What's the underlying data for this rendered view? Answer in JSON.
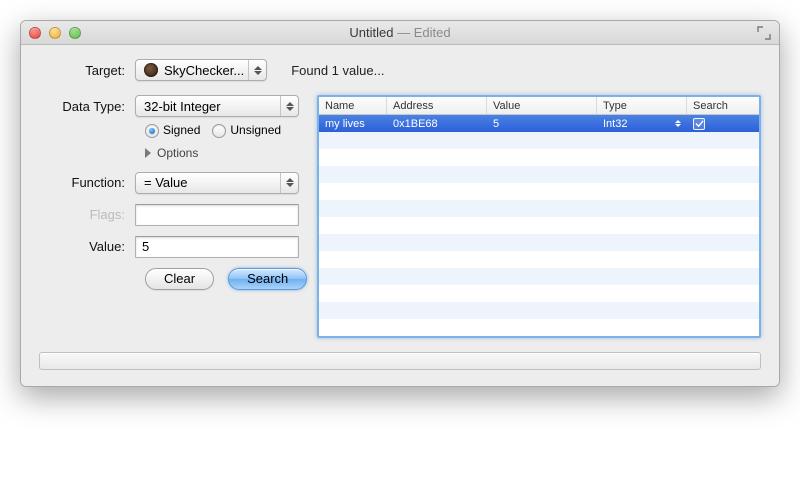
{
  "window": {
    "title": "Untitled",
    "edited_suffix": " — Edited"
  },
  "toprow": {
    "target_label": "Target:",
    "target_value": "SkyChecker...",
    "status_text": "Found 1 value..."
  },
  "form": {
    "data_type_label": "Data Type:",
    "data_type_value": "32-bit Integer",
    "signed_label": "Signed",
    "unsigned_label": "Unsigned",
    "signed_selected": true,
    "options_label": "Options",
    "function_label": "Function:",
    "function_value": "= Value",
    "flags_label": "Flags:",
    "flags_value": "",
    "value_label": "Value:",
    "value_value": "5",
    "clear_button": "Clear",
    "search_button": "Search"
  },
  "table": {
    "columns": {
      "name": "Name",
      "address": "Address",
      "value": "Value",
      "type": "Type",
      "search": "Search"
    },
    "rows": [
      {
        "name": "my lives",
        "address": "0x1BE68",
        "value": "5",
        "type": "Int32",
        "search_checked": true,
        "selected": true
      }
    ],
    "blank_rows": 12
  }
}
